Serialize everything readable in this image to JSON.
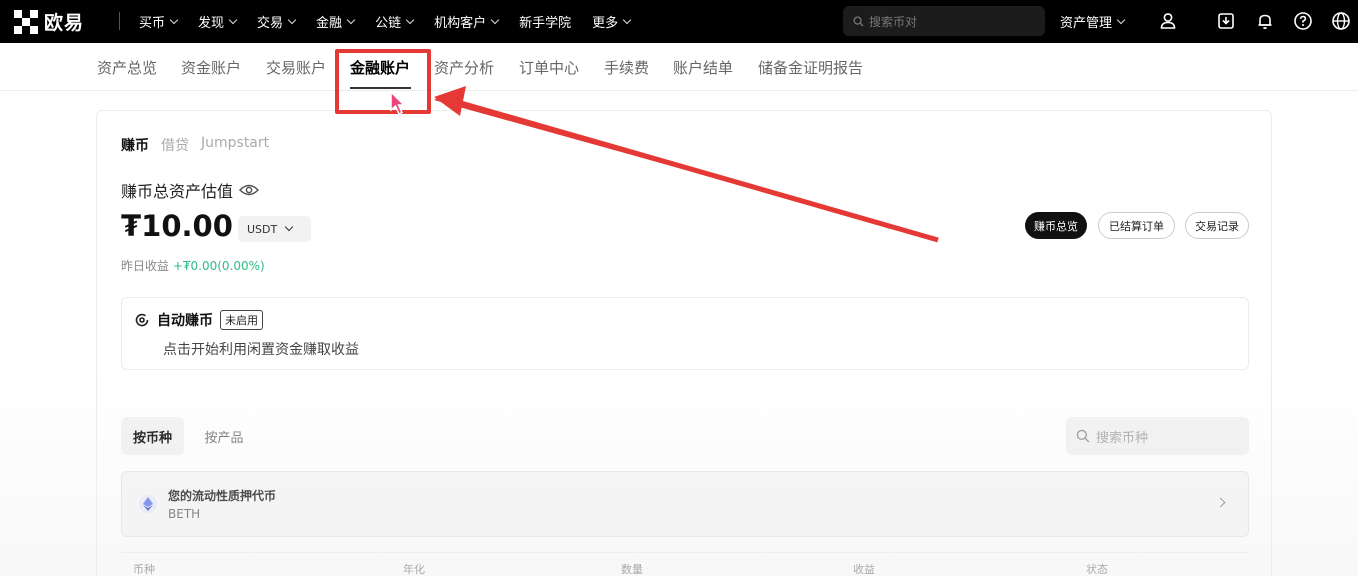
{
  "topnav": {
    "logo_text": "欧易",
    "items": [
      {
        "label": "买币",
        "dropdown": true
      },
      {
        "label": "发现",
        "dropdown": true
      },
      {
        "label": "交易",
        "dropdown": true
      },
      {
        "label": "金融",
        "dropdown": true
      },
      {
        "label": "公链",
        "dropdown": true
      },
      {
        "label": "机构客户",
        "dropdown": true
      },
      {
        "label": "新手学院",
        "dropdown": false
      },
      {
        "label": "更多",
        "dropdown": true
      }
    ],
    "search_placeholder": "搜索币对",
    "asset_management": "资产管理",
    "icons": [
      "user-icon",
      "download-icon",
      "bell-icon",
      "help-icon",
      "globe-icon"
    ]
  },
  "subtabs": {
    "items": [
      "资产总览",
      "资金账户",
      "交易账户",
      "金融账户",
      "资产分析",
      "订单中心",
      "手续费",
      "账户结单",
      "储备金证明报告"
    ],
    "active": "金融账户"
  },
  "earn": {
    "tabs": [
      "赚币",
      "借贷",
      "Jumpstart"
    ],
    "active_tab": "赚币",
    "total_label": "赚币总资产估值",
    "total_value": "₮10.00",
    "currency": "USDT",
    "yesterday_label": "昨日收益",
    "yesterday_value": "+₮0.00(0.00%)",
    "actions": [
      "赚币总览",
      "已结算订单",
      "交易记录"
    ],
    "active_action": "赚币总览"
  },
  "auto_earn": {
    "title": "自动赚币",
    "badge": "未启用",
    "description": "点击开始利用闲置资金赚取收益"
  },
  "list": {
    "view_tabs": [
      "按币种",
      "按产品"
    ],
    "active_view": "按币种",
    "search_placeholder": "搜索币种",
    "staking_title": "您的流动性质押代币",
    "staking_token": "BETH",
    "columns": [
      "币种",
      "年化",
      "数量",
      "收益",
      "状态"
    ]
  },
  "colors": {
    "annotation": "#e53935",
    "positive": "#2ebd85",
    "nav_bg": "#000000"
  }
}
